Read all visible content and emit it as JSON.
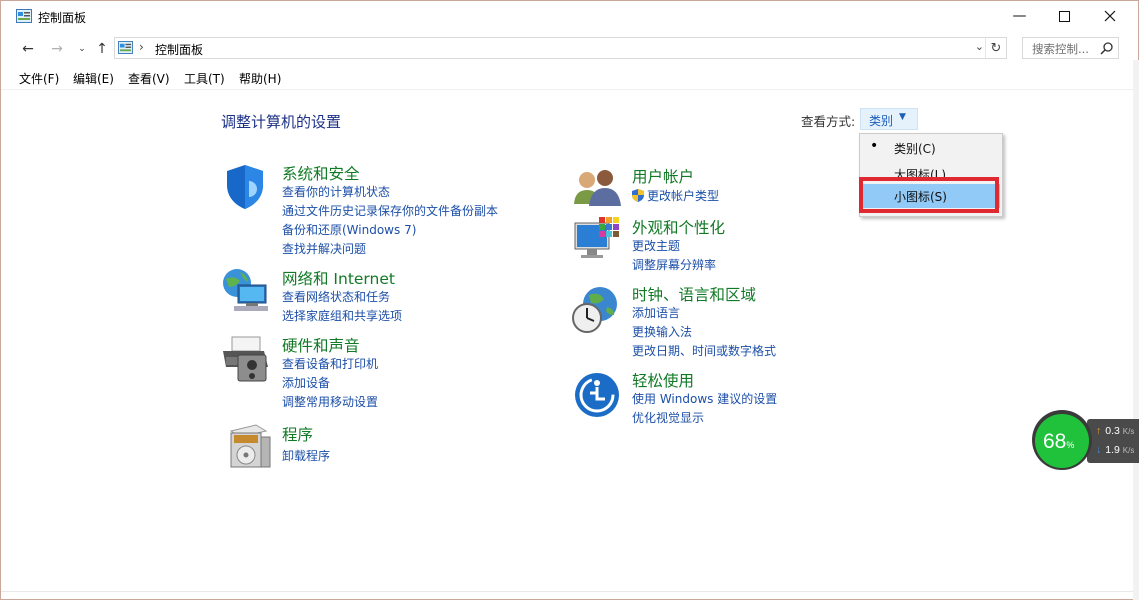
{
  "window": {
    "title": "控制面板"
  },
  "address": {
    "path": "控制面板",
    "search_placeholder": "搜索控制..."
  },
  "menubar": [
    "文件(F)",
    "编辑(E)",
    "查看(V)",
    "工具(T)",
    "帮助(H)"
  ],
  "main": {
    "heading": "调整计算机的设置",
    "view_by_label": "查看方式:",
    "view_by_value": "类别"
  },
  "view_menu": {
    "options": [
      "类别(C)",
      "大图标(L)",
      "小图标(S)"
    ],
    "selected_bullet": "•"
  },
  "categories_left": [
    {
      "title": "系统和安全",
      "icon": "shield-icon",
      "links": [
        "查看你的计算机状态",
        "通过文件历史记录保存你的文件备份副本",
        "备份和还原(Windows 7)",
        "查找并解决问题"
      ]
    },
    {
      "title": "网络和 Internet",
      "icon": "network-globe-icon",
      "links": [
        "查看网络状态和任务",
        "选择家庭组和共享选项"
      ]
    },
    {
      "title": "硬件和声音",
      "icon": "printer-speaker-icon",
      "links": [
        "查看设备和打印机",
        "添加设备",
        "调整常用移动设置"
      ]
    },
    {
      "title": "程序",
      "icon": "programs-icon",
      "links": [
        "卸载程序"
      ]
    }
  ],
  "categories_right": [
    {
      "title": "用户帐户",
      "icon": "users-icon",
      "links": [
        "更改帐户类型"
      ]
    },
    {
      "title": "外观和个性化",
      "icon": "appearance-icon",
      "links": [
        "更改主题",
        "调整屏幕分辨率"
      ]
    },
    {
      "title": "时钟、语言和区域",
      "icon": "clock-globe-icon",
      "links": [
        "添加语言",
        "更换输入法",
        "更改日期、时间或数字格式"
      ]
    },
    {
      "title": "轻松使用",
      "icon": "ease-of-access-icon",
      "links": [
        "使用 Windows 建议的设置",
        "优化视觉显示"
      ]
    }
  ],
  "net_monitor": {
    "percent": "68",
    "percent_sign": "%",
    "up": "0.3",
    "down": "1.9",
    "unit": "K/s"
  }
}
